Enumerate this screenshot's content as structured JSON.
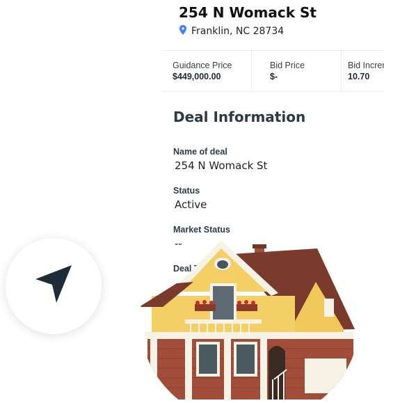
{
  "property": {
    "title": "254 N Womack St",
    "location": "Franklin, NC 28734"
  },
  "prices": [
    {
      "label": "Guidance Price",
      "value": "$449,000.00"
    },
    {
      "label": "Bid Price",
      "value": "$-"
    },
    {
      "label": "Bid Increment",
      "value": "10.70"
    }
  ],
  "deal": {
    "heading": "Deal Information",
    "fields": [
      {
        "label": "Name of deal",
        "value": "254 N Womack St"
      },
      {
        "label": "Status",
        "value": "Active"
      },
      {
        "label": "Market Status",
        "value": "--"
      },
      {
        "label": "Deal Type",
        "value": ""
      }
    ]
  },
  "icons": {
    "location": "map-pin-icon",
    "navigation": "navigation-arrow-icon"
  },
  "colors": {
    "pin": "#3b82f6",
    "arrow": "#1f2d38",
    "heading": "#2d3a45"
  }
}
